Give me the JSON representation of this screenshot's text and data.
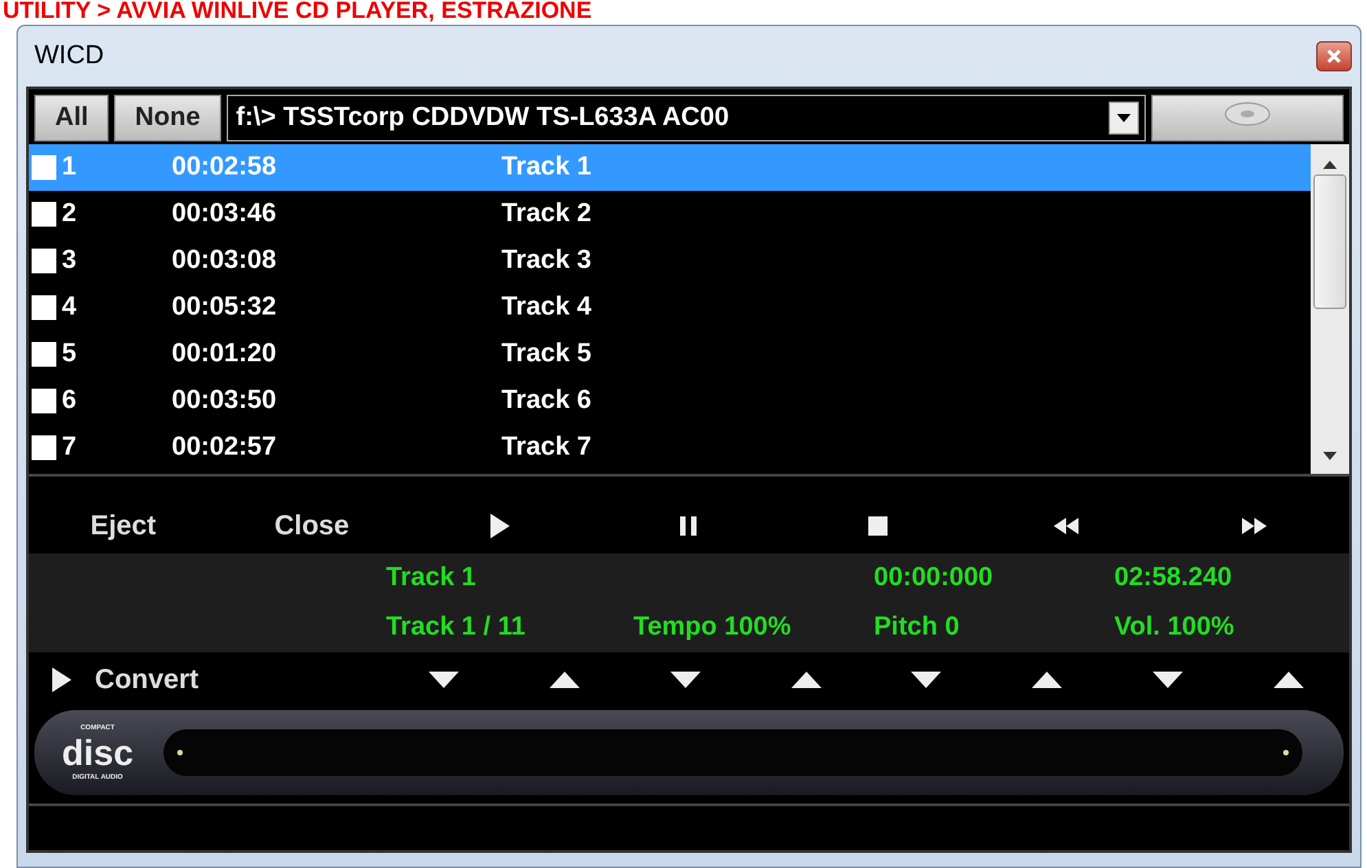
{
  "heading": "UTILITY > AVVIA WINLIVE CD PLAYER, ESTRAZIONE",
  "window": {
    "title": "WICD"
  },
  "toolbar": {
    "all_button": "All",
    "none_button": "None",
    "drive": "f:\\> TSSTcorp CDDVDW TS-L633A AC00"
  },
  "tracks": [
    {
      "number": "1",
      "duration": "00:02:58",
      "title": "Track 1",
      "checked": false,
      "selected": true
    },
    {
      "number": "2",
      "duration": "00:03:46",
      "title": "Track 2",
      "checked": false,
      "selected": false
    },
    {
      "number": "3",
      "duration": "00:03:08",
      "title": "Track 3",
      "checked": false,
      "selected": false
    },
    {
      "number": "4",
      "duration": "00:05:32",
      "title": "Track 4",
      "checked": false,
      "selected": false
    },
    {
      "number": "5",
      "duration": "00:01:20",
      "title": "Track 5",
      "checked": false,
      "selected": false
    },
    {
      "number": "6",
      "duration": "00:03:50",
      "title": "Track 6",
      "checked": false,
      "selected": false
    },
    {
      "number": "7",
      "duration": "00:02:57",
      "title": "Track 7",
      "checked": false,
      "selected": false
    }
  ],
  "controls": [
    {
      "kind": "text",
      "label": "Eject"
    },
    {
      "kind": "text",
      "label": "Close"
    },
    {
      "kind": "play"
    },
    {
      "kind": "pause"
    },
    {
      "kind": "stop"
    },
    {
      "kind": "rewind"
    },
    {
      "kind": "forward"
    }
  ],
  "info": {
    "current_track": "Track 1",
    "position": "00:00:000",
    "length": "02:58.240",
    "track_count": "Track 1 / 11",
    "tempo": "Tempo 100%",
    "pitch": "Pitch 0",
    "volume": "Vol. 100%"
  },
  "convert": {
    "label": "Convert",
    "adjusters": [
      {
        "kind": "down"
      },
      {
        "kind": "up"
      },
      {
        "kind": "down"
      },
      {
        "kind": "up"
      },
      {
        "kind": "down"
      },
      {
        "kind": "up"
      },
      {
        "kind": "down"
      },
      {
        "kind": "up"
      }
    ]
  },
  "logo": {
    "top": "COMPACT",
    "main": "disc",
    "bottom": "DIGITAL AUDIO"
  }
}
